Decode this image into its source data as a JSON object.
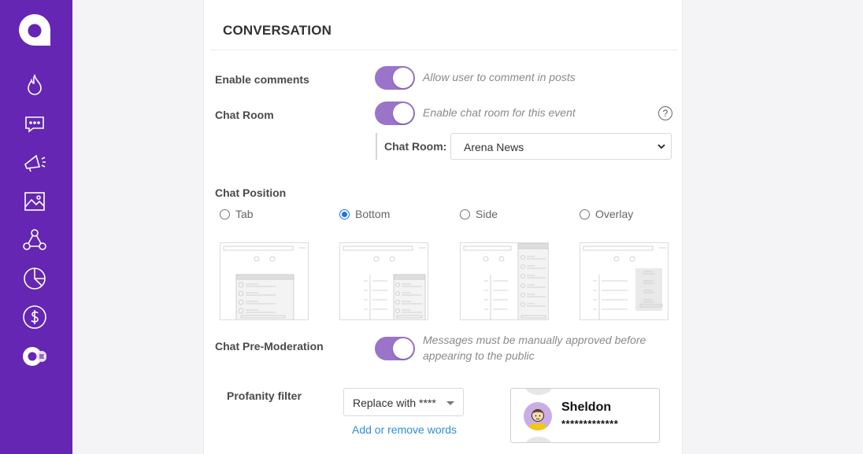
{
  "colors": {
    "brand": "#6526b3",
    "toggle_on": "#9a74c9",
    "link": "#2b8fd6"
  },
  "sidebar": {
    "logo": "arena-logo",
    "items": [
      {
        "icon": "flame-icon"
      },
      {
        "icon": "chat-icon"
      },
      {
        "icon": "megaphone-icon"
      },
      {
        "icon": "image-icon"
      },
      {
        "icon": "network-icon"
      },
      {
        "icon": "pie-chart-icon"
      },
      {
        "icon": "dollar-icon"
      },
      {
        "icon": "arena-app-icon"
      }
    ]
  },
  "conversation": {
    "title": "CONVERSATION",
    "enable_comments": {
      "label": "Enable comments",
      "hint": "Allow user to comment in posts",
      "on": true
    },
    "chat_room": {
      "label": "Chat Room",
      "hint": "Enable chat room for this event",
      "on": true,
      "help": "?",
      "select_label": "Chat Room:",
      "selected": "Arena News"
    },
    "chat_position": {
      "label": "Chat Position",
      "options": [
        "Tab",
        "Bottom",
        "Side",
        "Overlay"
      ],
      "selected": "Bottom"
    },
    "pre_moderation": {
      "label": "Chat Pre-Moderation",
      "hint_line1": "Messages must be manually approved before",
      "hint_line2": "appearing to the public",
      "on": true
    },
    "profanity": {
      "label": "Profanity filter",
      "selected": "Replace with ****",
      "link": "Add or remove words",
      "sample_name": "Sheldon",
      "sample_masked": "*************"
    }
  }
}
